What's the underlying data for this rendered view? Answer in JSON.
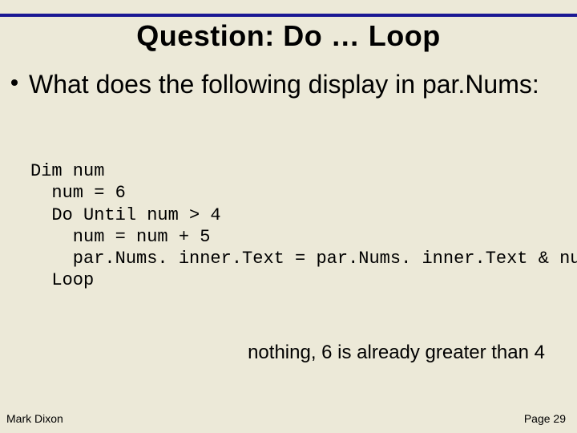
{
  "title": "Question: Do … Loop",
  "bullet": "What does the following display in par.Nums:",
  "code": "Dim num\n  num = 6\n  Do Until num > 4\n    num = num + 5\n    par.Nums. inner.Text = par.Nums. inner.Text & num\n  Loop",
  "answer": "nothing, 6 is already greater than 4",
  "footer": {
    "author": "Mark Dixon",
    "page": "Page 29"
  }
}
